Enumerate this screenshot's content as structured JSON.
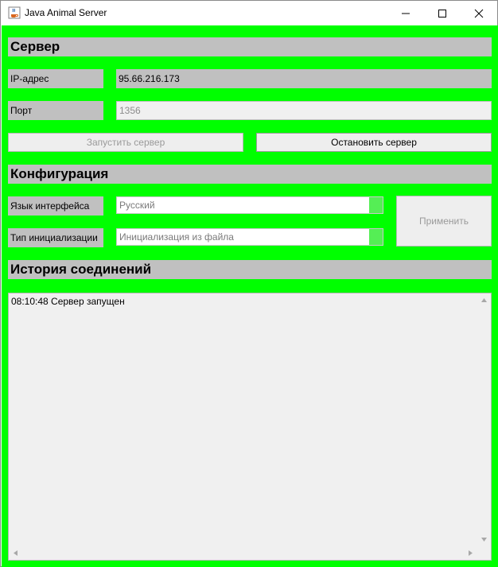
{
  "window": {
    "title": "Java Animal Server",
    "minimize_icon": "minimize-icon",
    "maximize_icon": "maximize-icon",
    "close_icon": "close-icon",
    "app_icon": "java-cup-icon"
  },
  "server": {
    "header": "Сервер",
    "ip_label": "IP-адрес",
    "ip_value": "95.66.216.173",
    "port_label": "Порт",
    "port_value": "1356",
    "start_button": "Запустить сервер",
    "stop_button": "Остановить сервер"
  },
  "config": {
    "header": "Конфигурация",
    "language_label": "Язык интерфейса",
    "language_value": "Русский",
    "init_label": "Тип инициализации",
    "init_value": "Инициализация из файла",
    "apply_button": "Применить"
  },
  "history": {
    "header": "История соединений",
    "log_lines": [
      "08:10:48 Сервер запущен"
    ]
  },
  "colors": {
    "background": "#00ff00",
    "panel": "#c0c0c0",
    "combo_arrow": "#55ee55"
  }
}
